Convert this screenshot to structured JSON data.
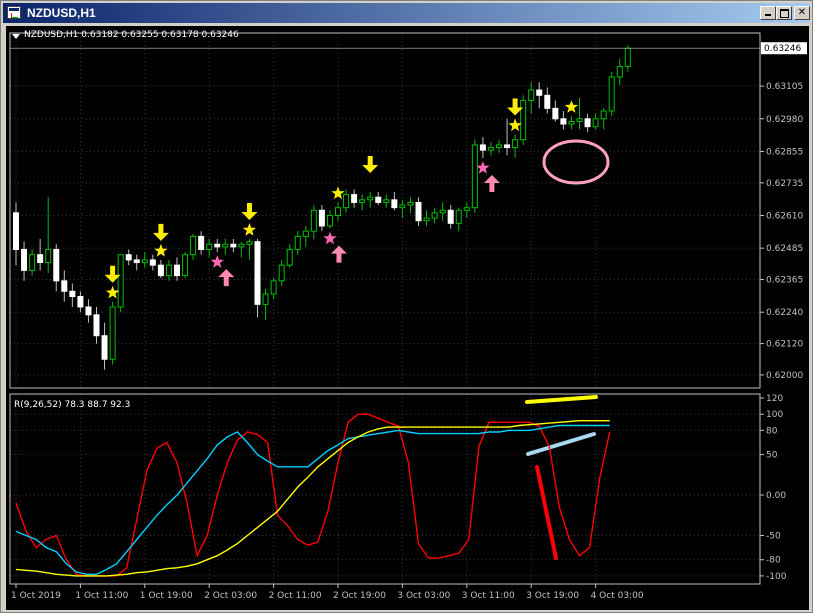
{
  "window": {
    "title": "NZDUSD,H1",
    "buttons": [
      "minimize",
      "maximize",
      "close"
    ]
  },
  "colors": {
    "background": "#000000",
    "grid": "#3a3a3a",
    "axis": "#c0c0c0",
    "bull_candle": "#00c000",
    "bull_body": "#000000",
    "bear_body": "#ffffff",
    "bear_wick": "#c0c0c0",
    "star_yellow": "#ffee00",
    "star_pink": "#ff69b4",
    "arrow_yellow": "#ffee00",
    "arrow_pink": "#ff8ab0",
    "line_red": "#ff0000",
    "line_cyan": "#00d0ff",
    "line_yellow": "#ffff00",
    "price_tag_bg": "#ffffff",
    "price_tag_fg": "#000000"
  },
  "price_panel": {
    "legend": "NZDUSD,H1  0.63182 0.63255 0.63178 0.63246",
    "current_price": "0.63246",
    "y_ticks": [
      "0.63105",
      "0.62980",
      "0.62855",
      "0.62735",
      "0.62610",
      "0.62485",
      "0.62365",
      "0.62240",
      "0.62120",
      "0.62000"
    ]
  },
  "indicator_panel": {
    "legend": "R(9,26,52) 78.3 88.7 92.3",
    "y_ticks": [
      "120",
      "100",
      "80",
      "50",
      "0.00",
      "-50",
      "-80",
      "-100"
    ]
  },
  "x_axis": {
    "labels": [
      "1 Oct 2019",
      "1 Oct 11:00",
      "1 Oct 19:00",
      "2 Oct 03:00",
      "2 Oct 11:00",
      "2 Oct 19:00",
      "3 Oct 03:00",
      "3 Oct 11:00",
      "3 Oct 19:00",
      "4 Oct 03:00"
    ]
  },
  "chart_data": [
    {
      "type": "candlestick",
      "title": "NZDUSD,H1",
      "ylim": [
        0.6195,
        0.6327
      ],
      "ohlc": [
        [
          0.6262,
          0.6266,
          0.6242,
          0.6248
        ],
        [
          0.6248,
          0.6251,
          0.6236,
          0.624
        ],
        [
          0.624,
          0.6248,
          0.6238,
          0.6246
        ],
        [
          0.6246,
          0.6252,
          0.624,
          0.6243
        ],
        [
          0.6243,
          0.6268,
          0.6239,
          0.6248
        ],
        [
          0.6248,
          0.625,
          0.6232,
          0.6236
        ],
        [
          0.6236,
          0.624,
          0.6228,
          0.6232
        ],
        [
          0.6232,
          0.6235,
          0.6226,
          0.623
        ],
        [
          0.623,
          0.6232,
          0.6224,
          0.6226
        ],
        [
          0.6226,
          0.6229,
          0.622,
          0.6223
        ],
        [
          0.6223,
          0.6226,
          0.6212,
          0.6215
        ],
        [
          0.6215,
          0.622,
          0.6202,
          0.6206
        ],
        [
          0.6206,
          0.6228,
          0.6204,
          0.6226
        ],
        [
          0.6226,
          0.6245,
          0.6224,
          0.6246
        ],
        [
          0.6246,
          0.6248,
          0.6242,
          0.6244
        ],
        [
          0.6244,
          0.6246,
          0.624,
          0.6243
        ],
        [
          0.6243,
          0.6247,
          0.6241,
          0.6244
        ],
        [
          0.6244,
          0.6246,
          0.624,
          0.6242
        ],
        [
          0.6242,
          0.6244,
          0.6237,
          0.6238
        ],
        [
          0.6238,
          0.6244,
          0.6236,
          0.6242
        ],
        [
          0.6242,
          0.6245,
          0.6236,
          0.6238
        ],
        [
          0.6238,
          0.6247,
          0.6237,
          0.6246
        ],
        [
          0.6246,
          0.6254,
          0.6244,
          0.6253
        ],
        [
          0.6253,
          0.6255,
          0.6246,
          0.6248
        ],
        [
          0.6248,
          0.6252,
          0.6245,
          0.625
        ],
        [
          0.625,
          0.6252,
          0.6247,
          0.6249
        ],
        [
          0.6249,
          0.6252,
          0.6246,
          0.625
        ],
        [
          0.625,
          0.6252,
          0.6247,
          0.6249
        ],
        [
          0.6249,
          0.6251,
          0.6245,
          0.625
        ],
        [
          0.625,
          0.6252,
          0.6244,
          0.6251
        ],
        [
          0.6251,
          0.6252,
          0.6222,
          0.6227
        ],
        [
          0.6227,
          0.6233,
          0.6221,
          0.6231
        ],
        [
          0.6231,
          0.6237,
          0.6229,
          0.6236
        ],
        [
          0.6236,
          0.6244,
          0.6234,
          0.6242
        ],
        [
          0.6242,
          0.625,
          0.6241,
          0.6248
        ],
        [
          0.6248,
          0.6255,
          0.6246,
          0.6253
        ],
        [
          0.6253,
          0.6257,
          0.6249,
          0.6255
        ],
        [
          0.6255,
          0.6265,
          0.6252,
          0.6263
        ],
        [
          0.6263,
          0.6265,
          0.6255,
          0.6257
        ],
        [
          0.6257,
          0.6263,
          0.6256,
          0.6261
        ],
        [
          0.6261,
          0.6266,
          0.6259,
          0.6264
        ],
        [
          0.6264,
          0.6271,
          0.6262,
          0.6269
        ],
        [
          0.6269,
          0.6271,
          0.6264,
          0.6266
        ],
        [
          0.6266,
          0.6269,
          0.6263,
          0.6267
        ],
        [
          0.6267,
          0.627,
          0.6264,
          0.6268
        ],
        [
          0.6268,
          0.627,
          0.6265,
          0.6266
        ],
        [
          0.6266,
          0.6269,
          0.6264,
          0.6267
        ],
        [
          0.6267,
          0.627,
          0.6263,
          0.6264
        ],
        [
          0.6264,
          0.6267,
          0.626,
          0.6265
        ],
        [
          0.6265,
          0.6268,
          0.6262,
          0.6266
        ],
        [
          0.6266,
          0.6268,
          0.6257,
          0.6259
        ],
        [
          0.6259,
          0.6263,
          0.6257,
          0.626
        ],
        [
          0.626,
          0.6264,
          0.6258,
          0.6262
        ],
        [
          0.6262,
          0.6266,
          0.6259,
          0.6263
        ],
        [
          0.6263,
          0.6265,
          0.6256,
          0.6258
        ],
        [
          0.6258,
          0.6264,
          0.6255,
          0.6263
        ],
        [
          0.6263,
          0.6266,
          0.626,
          0.6264
        ],
        [
          0.6264,
          0.629,
          0.6262,
          0.6288
        ],
        [
          0.6288,
          0.6291,
          0.6283,
          0.6286
        ],
        [
          0.6286,
          0.6289,
          0.6284,
          0.6287
        ],
        [
          0.6287,
          0.629,
          0.6285,
          0.6288
        ],
        [
          0.6288,
          0.6298,
          0.6284,
          0.6287
        ],
        [
          0.6287,
          0.6292,
          0.6283,
          0.629
        ],
        [
          0.629,
          0.6307,
          0.6288,
          0.6305
        ],
        [
          0.6305,
          0.6312,
          0.63,
          0.6309
        ],
        [
          0.6309,
          0.6312,
          0.6302,
          0.6307
        ],
        [
          0.6307,
          0.631,
          0.63,
          0.6302
        ],
        [
          0.6302,
          0.6305,
          0.6297,
          0.6298
        ],
        [
          0.6298,
          0.6301,
          0.6294,
          0.6296
        ],
        [
          0.6296,
          0.6299,
          0.6294,
          0.6297
        ],
        [
          0.6297,
          0.6306,
          0.6294,
          0.6298
        ],
        [
          0.6298,
          0.63,
          0.6293,
          0.6295
        ],
        [
          0.6295,
          0.63,
          0.6294,
          0.6298
        ],
        [
          0.6298,
          0.6302,
          0.6294,
          0.6301
        ],
        [
          0.6301,
          0.6316,
          0.6299,
          0.6314
        ],
        [
          0.6314,
          0.6321,
          0.6311,
          0.6318
        ],
        [
          0.6318,
          0.6326,
          0.6316,
          0.6325
        ]
      ],
      "yellow_stars": [
        12,
        18,
        29,
        40,
        62,
        69
      ],
      "pink_stars": [
        25,
        39,
        58
      ],
      "down_arrows": [
        12,
        18,
        29,
        44,
        62
      ],
      "up_arrows": [
        25,
        39,
        58
      ]
    },
    {
      "type": "line",
      "title": "R(9,26,52)",
      "ylim": [
        -110,
        125
      ],
      "series": [
        {
          "color": "#ff0000",
          "values": [
            -10,
            -45,
            -65,
            -55,
            -50,
            -80,
            -98,
            -100,
            -100,
            -100,
            -100,
            -90,
            -30,
            30,
            58,
            65,
            40,
            -10,
            -75,
            -50,
            0,
            40,
            68,
            78,
            75,
            65,
            -25,
            -38,
            -55,
            -62,
            -58,
            -20,
            40,
            90,
            100,
            100,
            95,
            90,
            85,
            40,
            -60,
            -78,
            -78,
            -75,
            -72,
            -55,
            60,
            90,
            90,
            90,
            90,
            90,
            85,
            60,
            -15,
            -55,
            -75,
            -65,
            20,
            78
          ]
        },
        {
          "color": "#00d0ff",
          "values": [
            -45,
            -50,
            -55,
            -65,
            -70,
            -85,
            -95,
            -98,
            -98,
            -92,
            -85,
            -70,
            -55,
            -40,
            -25,
            -12,
            0,
            15,
            30,
            45,
            62,
            72,
            78,
            65,
            50,
            42,
            35,
            35,
            35,
            35,
            45,
            55,
            62,
            70,
            72,
            74,
            76,
            78,
            80,
            78,
            76,
            76,
            76,
            76,
            76,
            76,
            76,
            78,
            78,
            80,
            80,
            80,
            82,
            84,
            86,
            86,
            86,
            86,
            86,
            86
          ]
        },
        {
          "color": "#ffff00",
          "values": [
            -92,
            -93,
            -94,
            -96,
            -98,
            -99,
            -100,
            -100,
            -100,
            -100,
            -99,
            -98,
            -96,
            -95,
            -93,
            -91,
            -90,
            -88,
            -85,
            -80,
            -75,
            -68,
            -60,
            -50,
            -40,
            -30,
            -20,
            -5,
            10,
            22,
            35,
            45,
            55,
            65,
            72,
            78,
            82,
            84,
            84,
            84,
            84,
            84,
            84,
            84,
            84,
            84,
            84,
            84,
            84,
            84,
            86,
            87,
            88,
            89,
            90,
            91,
            92,
            92,
            92,
            92
          ]
        }
      ]
    }
  ]
}
